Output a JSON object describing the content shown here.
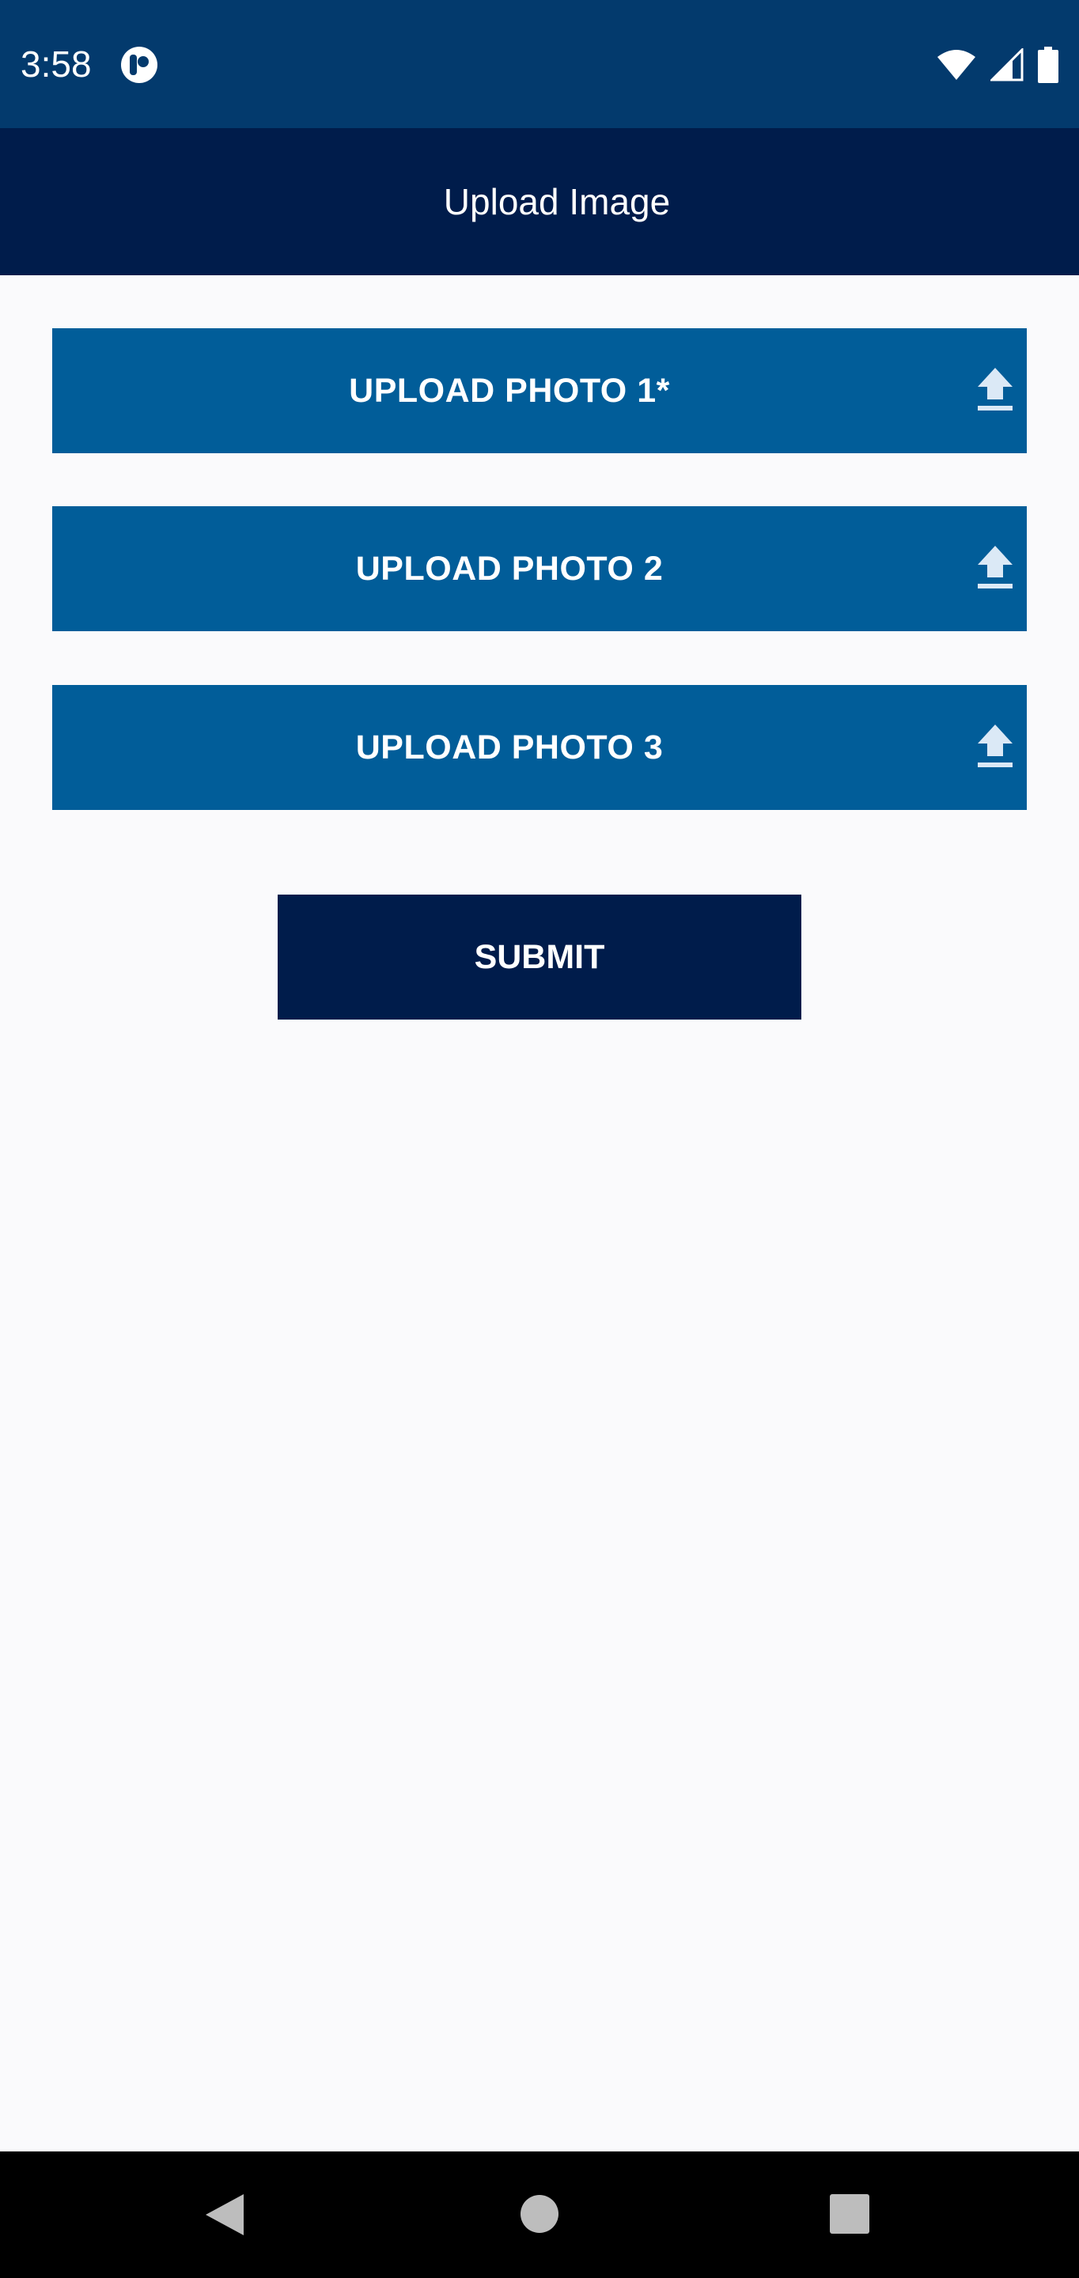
{
  "status_bar": {
    "time": "3:58",
    "app_icon": "notification-app-icon",
    "wifi_icon": "wifi-icon",
    "signal_icon": "cell-signal-icon",
    "battery_icon": "battery-icon",
    "color": "#033a6d"
  },
  "app_bar": {
    "title": "Upload Image",
    "color": "#001c4b"
  },
  "uploads": [
    {
      "label": "UPLOAD PHOTO 1*",
      "icon": "upload-icon"
    },
    {
      "label": "UPLOAD PHOTO 2",
      "icon": "upload-icon"
    },
    {
      "label": "UPLOAD PHOTO 3",
      "icon": "upload-icon"
    }
  ],
  "upload_button_color": "#015d99",
  "submit": {
    "label": "SUBMIT",
    "color": "#001c4b"
  },
  "nav_bar": {
    "back_icon": "back-triangle-icon",
    "home_icon": "home-circle-icon",
    "recents_icon": "recents-square-icon"
  }
}
